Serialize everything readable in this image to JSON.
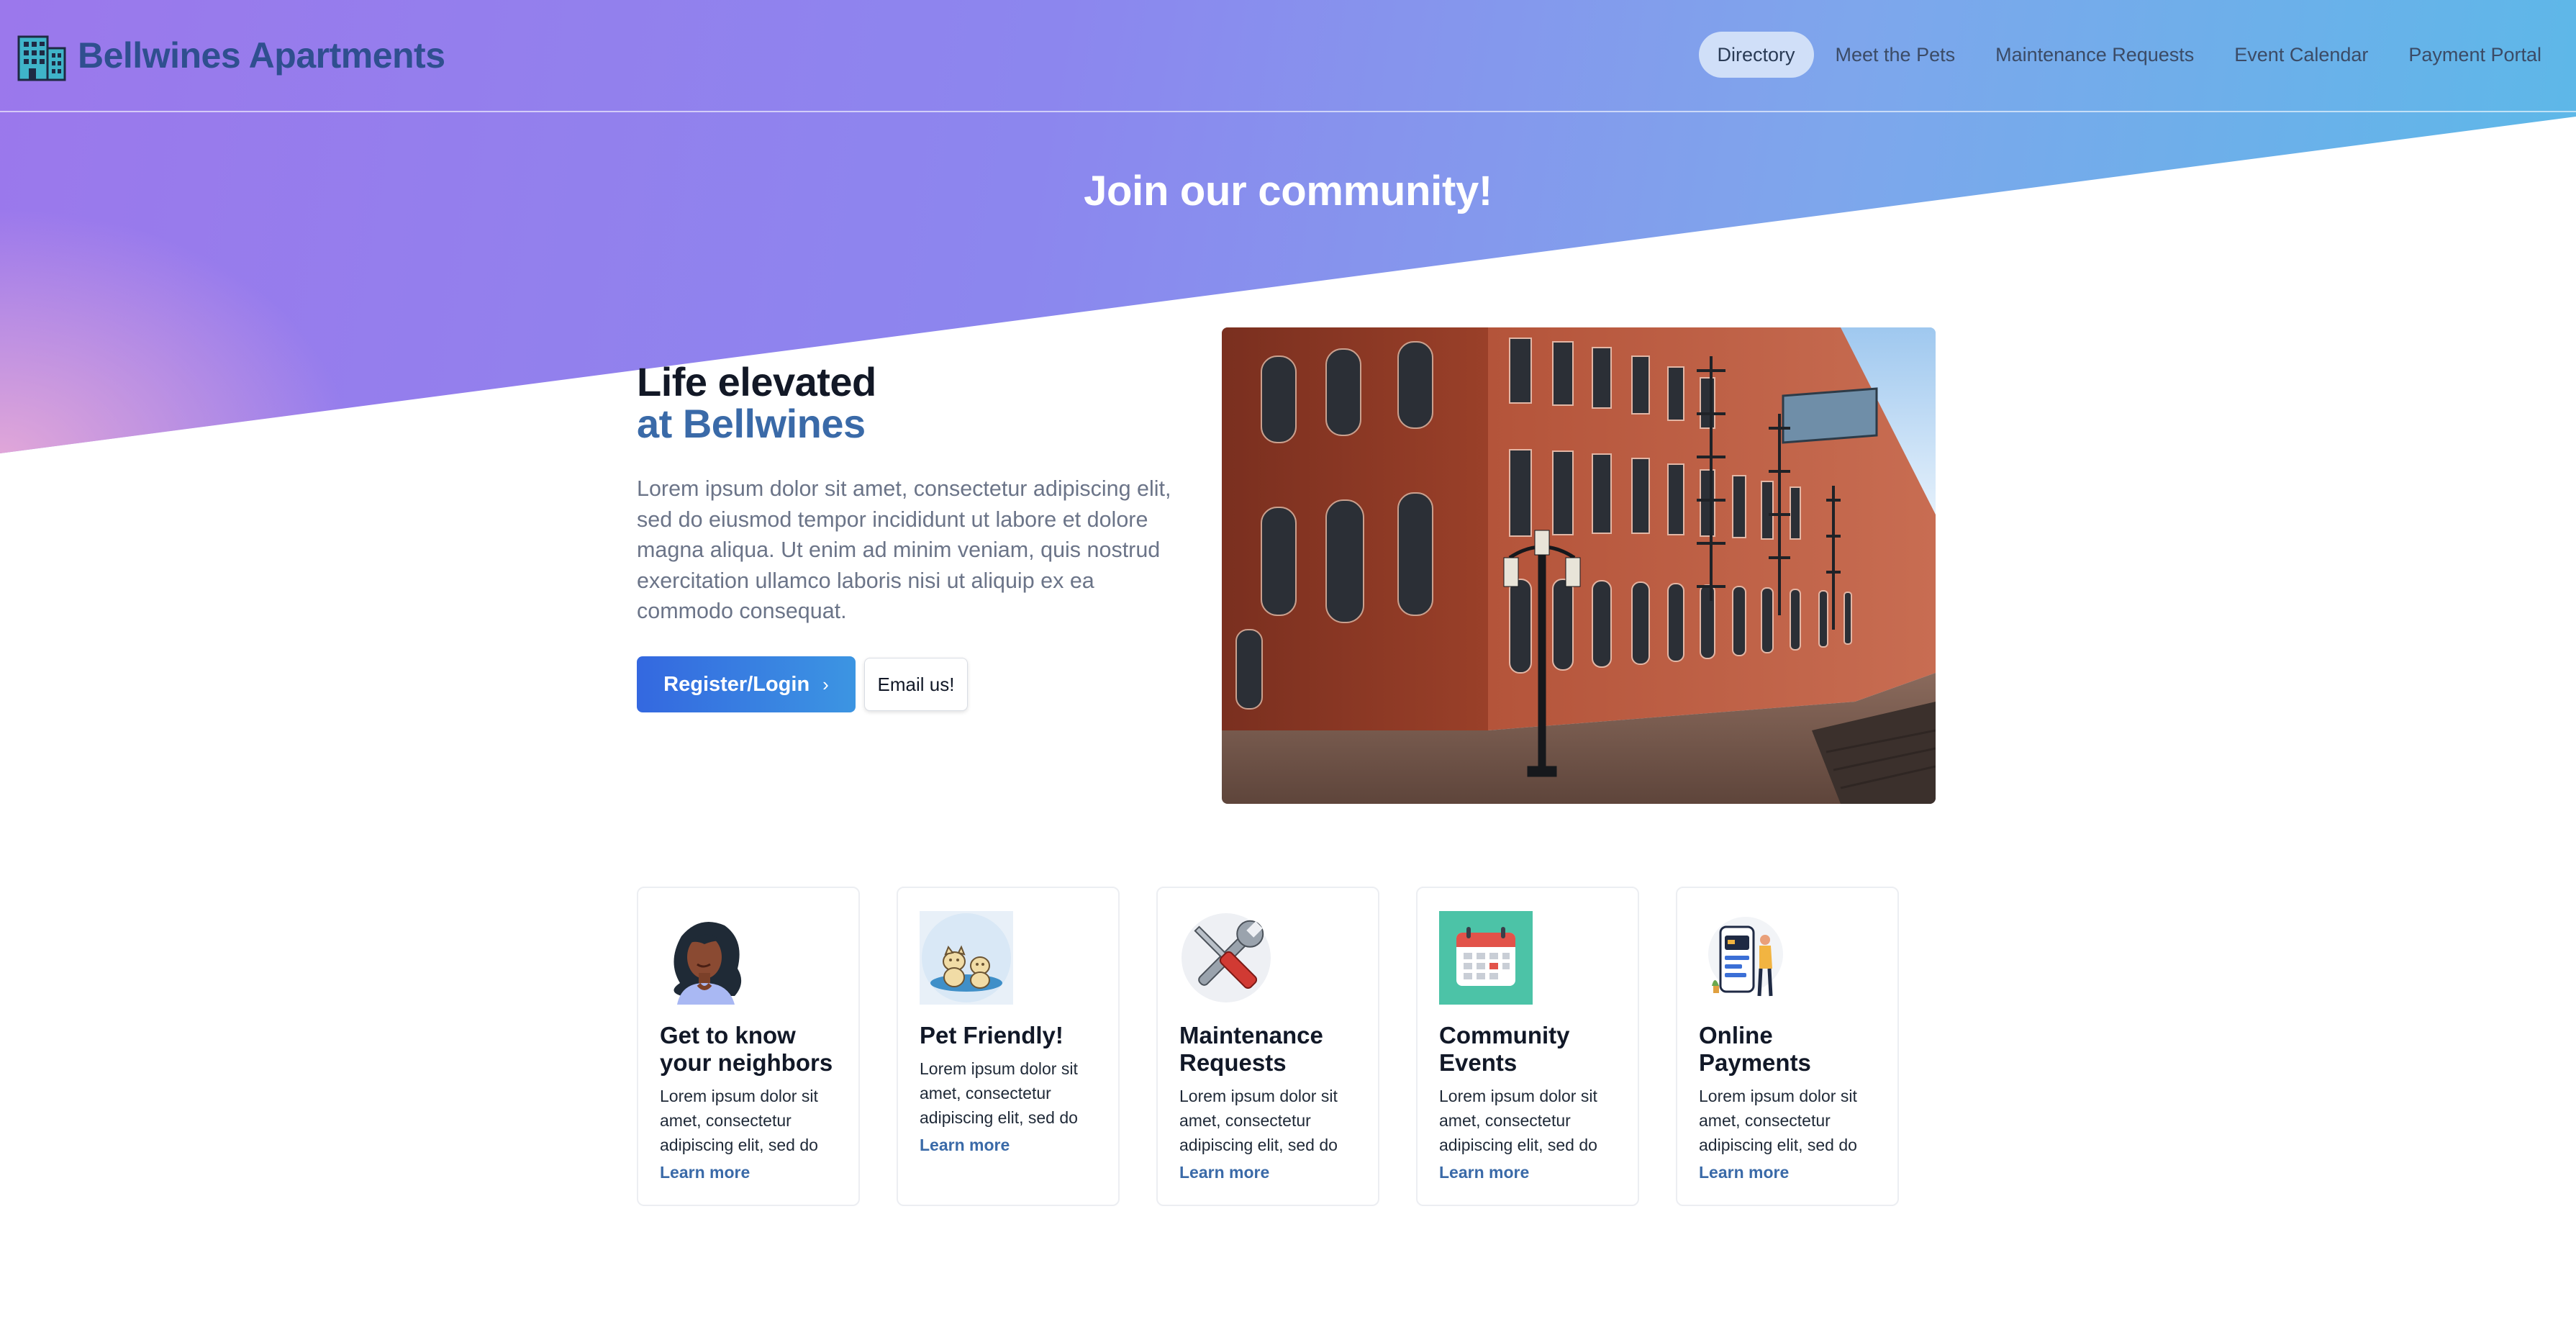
{
  "brand": {
    "name": "Bellwines Apartments",
    "icon": "building-icon"
  },
  "nav": {
    "items": [
      {
        "label": "Directory",
        "active": true
      },
      {
        "label": "Meet the Pets",
        "active": false
      },
      {
        "label": "Maintenance Requests",
        "active": false
      },
      {
        "label": "Event Calendar",
        "active": false
      },
      {
        "label": "Payment Portal",
        "active": false
      }
    ]
  },
  "hero": {
    "heading": "Join our community!"
  },
  "intro": {
    "title_line1": "Life elevated",
    "title_line2": "at Bellwines",
    "body": "Lorem ipsum dolor sit amet, consectetur adipiscing elit, sed do eiusmod tempor incididunt ut labore et dolore magna aliqua. Ut enim ad minim veniam, quis nostrud exercitation ullamco laboris nisi ut aliquip ex ea commodo consequat.",
    "primary_button": "Register/Login",
    "primary_button_icon": "chevron-right-icon",
    "secondary_button": "Email us!",
    "photo": "brick-apartment-building-photo"
  },
  "features": [
    {
      "icon": "woman-avatar-icon",
      "title": "Get to know your neighbors",
      "text": "Lorem ipsum dolor sit amet, consectetur adipiscing elit, sed do",
      "link": "Learn more"
    },
    {
      "icon": "pets-icon",
      "title": "Pet Friendly!",
      "text": "Lorem ipsum dolor sit amet, consectetur adipiscing elit, sed do",
      "link": "Learn more"
    },
    {
      "icon": "wrench-screwdriver-icon",
      "title": "Maintenance Requests",
      "text": "Lorem ipsum dolor sit amet, consectetur adipiscing elit, sed do",
      "link": "Learn more"
    },
    {
      "icon": "calendar-icon",
      "title": "Community Events",
      "text": "Lorem ipsum dolor sit amet, consectetur adipiscing elit, sed do",
      "link": "Learn more"
    },
    {
      "icon": "mobile-payment-icon",
      "title": "Online Payments",
      "text": "Lorem ipsum dolor sit amet, consectetur adipiscing elit, sed do",
      "link": "Learn more"
    }
  ],
  "colors": {
    "brand_text": "#2f4f8f",
    "accent_blue": "#3a6aa8",
    "gradient_start": "#9b78ec",
    "gradient_end": "#5bb9e8",
    "button_start": "#3468e0",
    "button_end": "#3c95e2"
  }
}
